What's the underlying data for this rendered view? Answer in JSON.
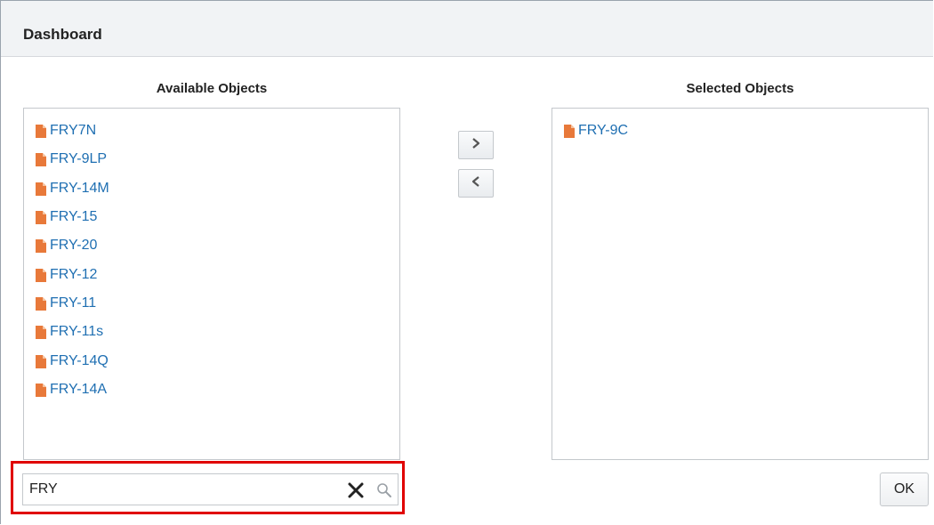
{
  "dialog": {
    "title": "Dashboard"
  },
  "available": {
    "title": "Available Objects",
    "items": [
      "FRY7N",
      "FRY-9LP",
      "FRY-14M",
      "FRY-15",
      "FRY-20",
      "FRY-12",
      "FRY-11",
      "FRY-11s",
      "FRY-14Q",
      "FRY-14A"
    ]
  },
  "selected": {
    "title": "Selected Objects",
    "items": [
      "FRY-9C"
    ]
  },
  "search": {
    "value": "FRY"
  },
  "buttons": {
    "ok": "OK"
  },
  "icons": {
    "item": "document-icon",
    "move_right": "chevron-right-icon",
    "move_left": "chevron-left-icon",
    "clear": "close-icon",
    "search": "search-icon"
  },
  "colors": {
    "link": "#1f6fb2",
    "document_icon": "#e8793a",
    "highlight": "#e00000"
  }
}
